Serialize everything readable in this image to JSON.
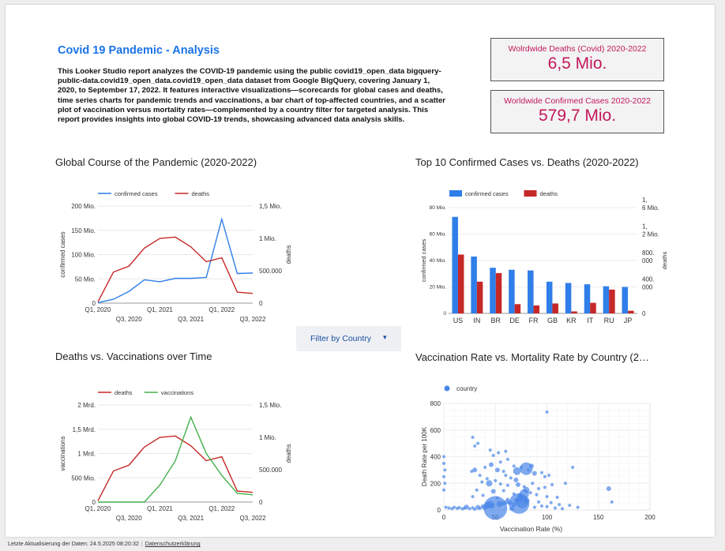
{
  "report": {
    "title": "Covid 19 Pandemic - Analysis",
    "description": "This Looker Studio report analyzes the COVID-19 pandemic using the public covid19_open_data bigquery-public-data.covid19_open_data.covid19_open_data dataset from Google BigQuery, covering January 1, 2020, to September 17, 2022. It features interactive visualizations—scorecards for global cases and deaths, time series charts for pandemic trends and vaccinations, a bar chart of top-affected countries, and a scatter plot of vaccination versus mortality rates—complemented by a country filter for targeted analysis. This report provides insights into global COVID-19 trends, showcasing advanced data analysis skills."
  },
  "scorecards": [
    {
      "label": "Wolrdwide Deaths (Covid) 2020-2022",
      "value": "6,5 Mio."
    },
    {
      "label": "Worldwide Confirmed Cases 2020-2022",
      "value": "579,7 Mio."
    }
  ],
  "filter": {
    "label": "Filter by Country",
    "caret": "▾"
  },
  "footer": {
    "updated": "Letzte Aktualisierung der Daten: 24.5.2025 08:20:32",
    "separator": "|",
    "privacy": "Datenschutzerklärung"
  },
  "colors": {
    "blue": "#2f7ee9",
    "red": "#c62828",
    "green": "#43b04a",
    "accent": "#1a73e8",
    "scorecard": "#c2185b"
  },
  "chart_data": [
    {
      "id": "course",
      "type": "line",
      "title": "Global Course of the Pandemic (2020-2022)",
      "ylabel": "confirmed cases",
      "y2label": "deaths",
      "ylim": [
        0,
        200
      ],
      "y2lim": [
        0,
        1.5
      ],
      "yticks": [
        "0",
        "50 Mio.",
        "100 Mio.",
        "150 Mio.",
        "200 Mio."
      ],
      "y2ticks": [
        "0",
        "500.000",
        "1 Mio.",
        "1,5 Mio."
      ],
      "xticks": [
        {
          "label": "Q1, 2020",
          "row": 1,
          "i": 0
        },
        {
          "label": "Q3, 2020",
          "row": 2,
          "i": 2
        },
        {
          "label": "Q1, 2021",
          "row": 1,
          "i": 4
        },
        {
          "label": "Q3, 2021",
          "row": 2,
          "i": 6
        },
        {
          "label": "Q1, 2022",
          "row": 1,
          "i": 8
        },
        {
          "label": "Q3, 2022",
          "row": 2,
          "i": 10
        }
      ],
      "legend": "top",
      "series": [
        {
          "name": "confirmed cases",
          "color": "#2f7ee9",
          "axis": "left",
          "values": [
            1,
            8,
            24,
            48,
            44,
            51,
            51,
            53,
            173,
            61,
            62
          ]
        },
        {
          "name": "deaths",
          "color": "#c62828",
          "axis": "right",
          "values": [
            0.02,
            0.48,
            0.57,
            0.85,
            1.0,
            1.02,
            0.87,
            0.64,
            0.7,
            0.17,
            0.15
          ]
        }
      ]
    },
    {
      "id": "top10",
      "type": "bar",
      "title": "Top 10 Confirmed Cases vs. Deaths (2020-2022)",
      "ylabel": "confirmed cases",
      "y2label": "deaths",
      "ylim": [
        0,
        80
      ],
      "yticks": [
        "0",
        "20 Mio.",
        "40 Mio.",
        "60 Mio.",
        "80 Mio."
      ],
      "y2ticks": [
        "0",
        "400.\n000",
        "800.\n000",
        "1,\n2 Mio.",
        "1,\n6 Mio."
      ],
      "categories": [
        "US",
        "IN",
        "BR",
        "DE",
        "FR",
        "GB",
        "KR",
        "IT",
        "RU",
        "JP"
      ],
      "legend": "top",
      "series": [
        {
          "name": "confirmed cases",
          "color": "#2f7ee9",
          "values": [
            73,
            43,
            34.5,
            33,
            32.5,
            24,
            23,
            22,
            20.5,
            20
          ]
        },
        {
          "name": "deaths",
          "color": "#c62828",
          "values": [
            44.5,
            24,
            30.5,
            7,
            6,
            7.5,
            1.5,
            8,
            18,
            2
          ]
        }
      ]
    },
    {
      "id": "vacc",
      "type": "line",
      "title": "Deaths vs. Vaccinations over Time",
      "ylabel": "vaccinations",
      "y2label": "deaths",
      "ylim": [
        0,
        2
      ],
      "y2lim": [
        0,
        1.5
      ],
      "yticks": [
        "0",
        "500 Mio.",
        "1 Mrd.",
        "1,5 Mrd.",
        "2 Mrd."
      ],
      "y2ticks": [
        "0",
        "500.000",
        "1 Mio.",
        "1,5 Mio."
      ],
      "xticks": [
        {
          "label": "Q1, 2020",
          "row": 1,
          "i": 0
        },
        {
          "label": "Q3, 2020",
          "row": 2,
          "i": 2
        },
        {
          "label": "Q1, 2021",
          "row": 1,
          "i": 4
        },
        {
          "label": "Q3, 2021",
          "row": 2,
          "i": 6
        },
        {
          "label": "Q1, 2022",
          "row": 1,
          "i": 8
        },
        {
          "label": "Q3, 2022",
          "row": 2,
          "i": 10
        }
      ],
      "legend": "top",
      "series": [
        {
          "name": "deaths",
          "color": "#c62828",
          "axis": "right",
          "values": [
            0.02,
            0.48,
            0.57,
            0.85,
            1.0,
            1.02,
            0.87,
            0.64,
            0.7,
            0.17,
            0.15
          ]
        },
        {
          "name": "vaccinations",
          "color": "#43b04a",
          "axis": "left",
          "values": [
            0,
            0,
            0,
            0,
            0.35,
            0.85,
            1.75,
            1.0,
            0.55,
            0.18,
            0.15
          ]
        }
      ]
    },
    {
      "id": "scatter",
      "type": "scatter",
      "title": "Vaccination Rate vs. Mortality Rate by Country (2…",
      "xlabel": "Vaccination Rate (%)",
      "ylabel": "Death Rate per 100K",
      "xlim": [
        0,
        200
      ],
      "ylim": [
        0,
        800
      ],
      "xticks": [
        "0",
        "50",
        "100",
        "150",
        "200"
      ],
      "yticks": [
        "0",
        "200",
        "400",
        "600",
        "800"
      ],
      "legend": "top-left",
      "series": [
        {
          "name": "country",
          "color": "#4a86e8",
          "points": [
            [
              100,
              735,
              2
            ],
            [
              28,
              545,
              2
            ],
            [
              30,
              480,
              2
            ],
            [
              33,
              500,
              2
            ],
            [
              45,
              450,
              2
            ],
            [
              53,
              430,
              2
            ],
            [
              60,
              440,
              2
            ],
            [
              48,
              410,
              2
            ],
            [
              62,
              380,
              2
            ],
            [
              55,
              360,
              2
            ],
            [
              46,
              340,
              3
            ],
            [
              68,
              330,
              2
            ],
            [
              40,
              320,
              2
            ],
            [
              52,
              300,
              3
            ],
            [
              75,
              320,
              2
            ],
            [
              82,
              300,
              2
            ],
            [
              85,
              330,
              3
            ],
            [
              58,
              290,
              2
            ],
            [
              80,
              310,
              8
            ],
            [
              71,
              292,
              5
            ],
            [
              88,
              275,
              3
            ],
            [
              95,
              280,
              2
            ],
            [
              98,
              250,
              2
            ],
            [
              60,
              260,
              2
            ],
            [
              65,
              240,
              2
            ],
            [
              70,
              225,
              3
            ],
            [
              50,
              220,
              2
            ],
            [
              42,
              235,
              2
            ],
            [
              35,
              260,
              2
            ],
            [
              102,
              260,
              2
            ],
            [
              30,
              300,
              3
            ],
            [
              27,
              290,
              2
            ],
            [
              37,
              210,
              2
            ],
            [
              44,
              200,
              4
            ],
            [
              55,
              195,
              2
            ],
            [
              62,
              185,
              2
            ],
            [
              72,
              190,
              3
            ],
            [
              78,
              175,
              2
            ],
            [
              86,
              200,
              2
            ],
            [
              92,
              160,
              2
            ],
            [
              98,
              170,
              2
            ],
            [
              105,
              190,
              2
            ],
            [
              118,
              200,
              2
            ],
            [
              32,
              150,
              2
            ],
            [
              48,
              140,
              3
            ],
            [
              58,
              145,
              2
            ],
            [
              68,
              120,
              2
            ],
            [
              74,
              110,
              3
            ],
            [
              84,
              130,
              2
            ],
            [
              90,
              115,
              2
            ],
            [
              100,
              100,
              2
            ],
            [
              110,
              95,
              2
            ],
            [
              38,
              110,
              2
            ],
            [
              28,
              100,
              2
            ],
            [
              52,
              90,
              2
            ],
            [
              62,
              80,
              2
            ],
            [
              70,
              75,
              2
            ],
            [
              80,
              70,
              4
            ],
            [
              92,
              60,
              2
            ],
            [
              104,
              55,
              2
            ],
            [
              112,
              40,
              2
            ],
            [
              2,
              20,
              2
            ],
            [
              5,
              15,
              2
            ],
            [
              8,
              10,
              2
            ],
            [
              10,
              20,
              2
            ],
            [
              13,
              12,
              2
            ],
            [
              15,
              18,
              2
            ],
            [
              18,
              8,
              2
            ],
            [
              20,
              14,
              2
            ],
            [
              22,
              22,
              3
            ],
            [
              25,
              10,
              2
            ],
            [
              28,
              16,
              2
            ],
            [
              30,
              5,
              2
            ],
            [
              33,
              20,
              3
            ],
            [
              35,
              12,
              2
            ],
            [
              38,
              25,
              3
            ],
            [
              40,
              18,
              3
            ],
            [
              42,
              35,
              4
            ],
            [
              45,
              40,
              5
            ],
            [
              47,
              30,
              3
            ],
            [
              50,
              15,
              15
            ],
            [
              54,
              45,
              4
            ],
            [
              58,
              50,
              3
            ],
            [
              61,
              60,
              3
            ],
            [
              64,
              55,
              3
            ],
            [
              68,
              40,
              3
            ],
            [
              71,
              70,
              3
            ],
            [
              74,
              90,
              4
            ],
            [
              76,
              60,
              8
            ],
            [
              73,
              48,
              13
            ],
            [
              78,
              120,
              6
            ],
            [
              80,
              150,
              4
            ],
            [
              66,
              10,
              3
            ],
            [
              88,
              20,
              2
            ],
            [
              95,
              30,
              2
            ],
            [
              100,
              25,
              2
            ],
            [
              108,
              15,
              2
            ],
            [
              115,
              10,
              2
            ],
            [
              122,
              35,
              2
            ],
            [
              130,
              20,
              2
            ],
            [
              160,
              160,
              3
            ],
            [
              163,
              60,
              2
            ],
            [
              125,
              320,
              2
            ],
            [
              0,
              400,
              2
            ],
            [
              0,
              350,
              2
            ],
            [
              1,
              300,
              2
            ],
            [
              0,
              250,
              2
            ],
            [
              1,
              200,
              2
            ],
            [
              0,
              150,
              2
            ]
          ]
        }
      ]
    }
  ]
}
